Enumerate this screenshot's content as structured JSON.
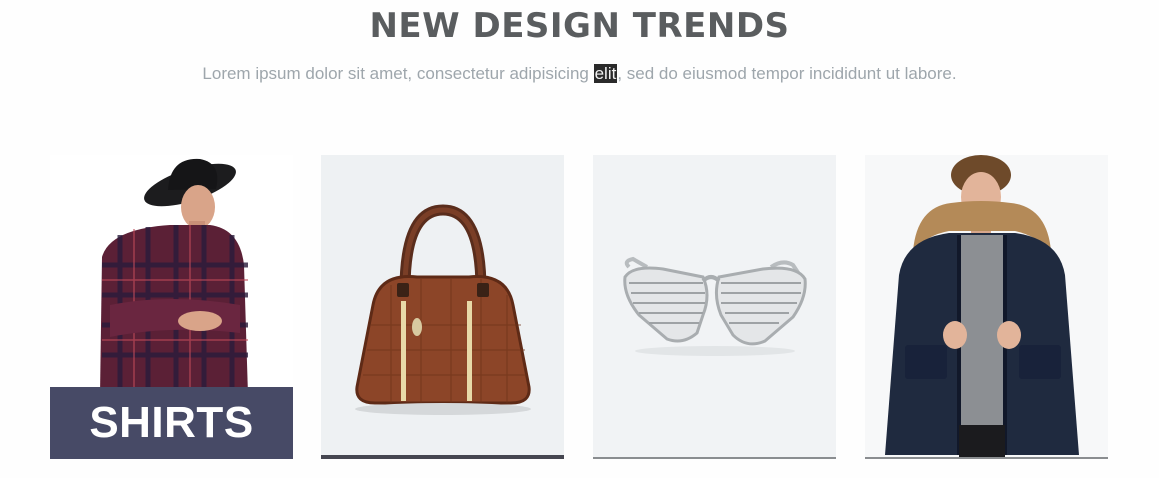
{
  "section": {
    "title": "NEW DESIGN TRENDS",
    "subtitle_before": "Lorem ipsum dolor sit amet, consectetur adipisicing ",
    "subtitle_highlight": "elit",
    "subtitle_after": ", sed do eiusmod tempor incididunt ut labore."
  },
  "products": [
    {
      "image": "man-in-plaid-shirt-and-hat",
      "label": "SHIRTS",
      "active": true
    },
    {
      "image": "brown-leather-handbag"
    },
    {
      "image": "shutter-shades-sunglasses"
    },
    {
      "image": "man-in-navy-parka-jacket"
    }
  ],
  "colors": {
    "heading": "#5a5d5f",
    "subtitle": "#9ea6ac",
    "label_overlay": "#474a66",
    "selection_highlight": "#2a2a2a"
  }
}
